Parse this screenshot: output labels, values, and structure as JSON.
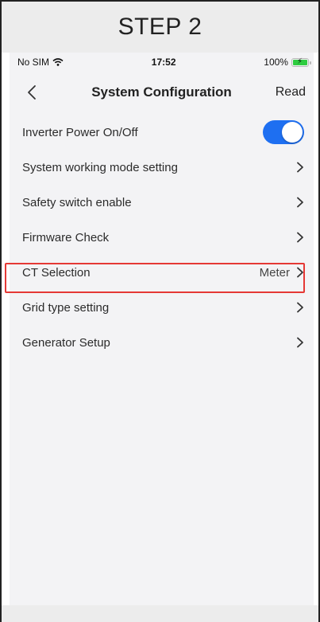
{
  "header": {
    "step": "STEP 2"
  },
  "status_bar": {
    "carrier": "No SIM",
    "time": "17:52",
    "battery": "100%"
  },
  "nav": {
    "title": "System Configuration",
    "read_label": "Read"
  },
  "settings": {
    "items": [
      {
        "label": "Inverter Power On/Off",
        "type": "toggle",
        "on": true
      },
      {
        "label": "System working mode setting",
        "type": "link"
      },
      {
        "label": "Safety switch enable",
        "type": "link"
      },
      {
        "label": "Firmware Check",
        "type": "link"
      },
      {
        "label": "CT Selection",
        "type": "link",
        "value": "Meter"
      },
      {
        "label": "Grid type setting",
        "type": "link",
        "highlighted": true
      },
      {
        "label": "Generator Setup",
        "type": "link"
      }
    ]
  },
  "colors": {
    "toggle_on": "#1e6ff1",
    "highlight": "#e53935"
  }
}
